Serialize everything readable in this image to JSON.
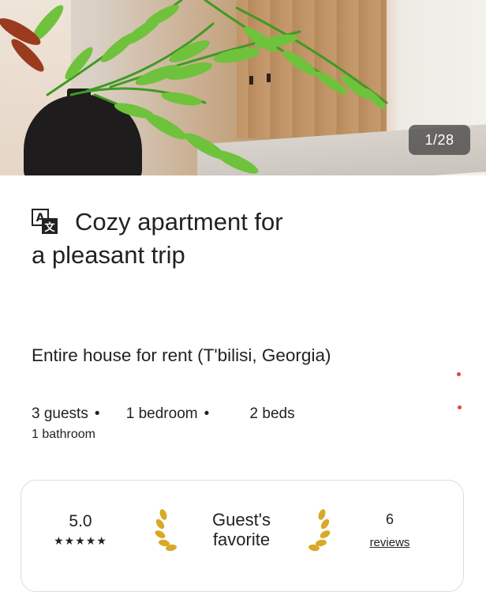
{
  "photo": {
    "counter": "1/28"
  },
  "listing": {
    "title_line1": "Cozy apartment for",
    "title_line2": "a pleasant trip",
    "subtitle": "Entire house for rent (T'bilisi, Georgia)",
    "details": {
      "guests": "3 guests",
      "bedrooms": "1 bedroom",
      "beds": "2 beds",
      "bathrooms": "1 bathroom",
      "separator": "•"
    }
  },
  "highlights": {
    "rating": "5.0",
    "stars": "★★★★★",
    "badge_line1": "Guest's",
    "badge_line2": "favorite",
    "review_count": "6",
    "review_label": "reviews"
  },
  "icons": {
    "translate": "translate-icon",
    "laurel_left": "laurel-left-icon",
    "laurel_right": "laurel-right-icon"
  },
  "colors": {
    "text": "#222222",
    "badge_bg": "#3c3c3c",
    "accent_dot": "#e0453a",
    "laurel": "#d9a826"
  }
}
